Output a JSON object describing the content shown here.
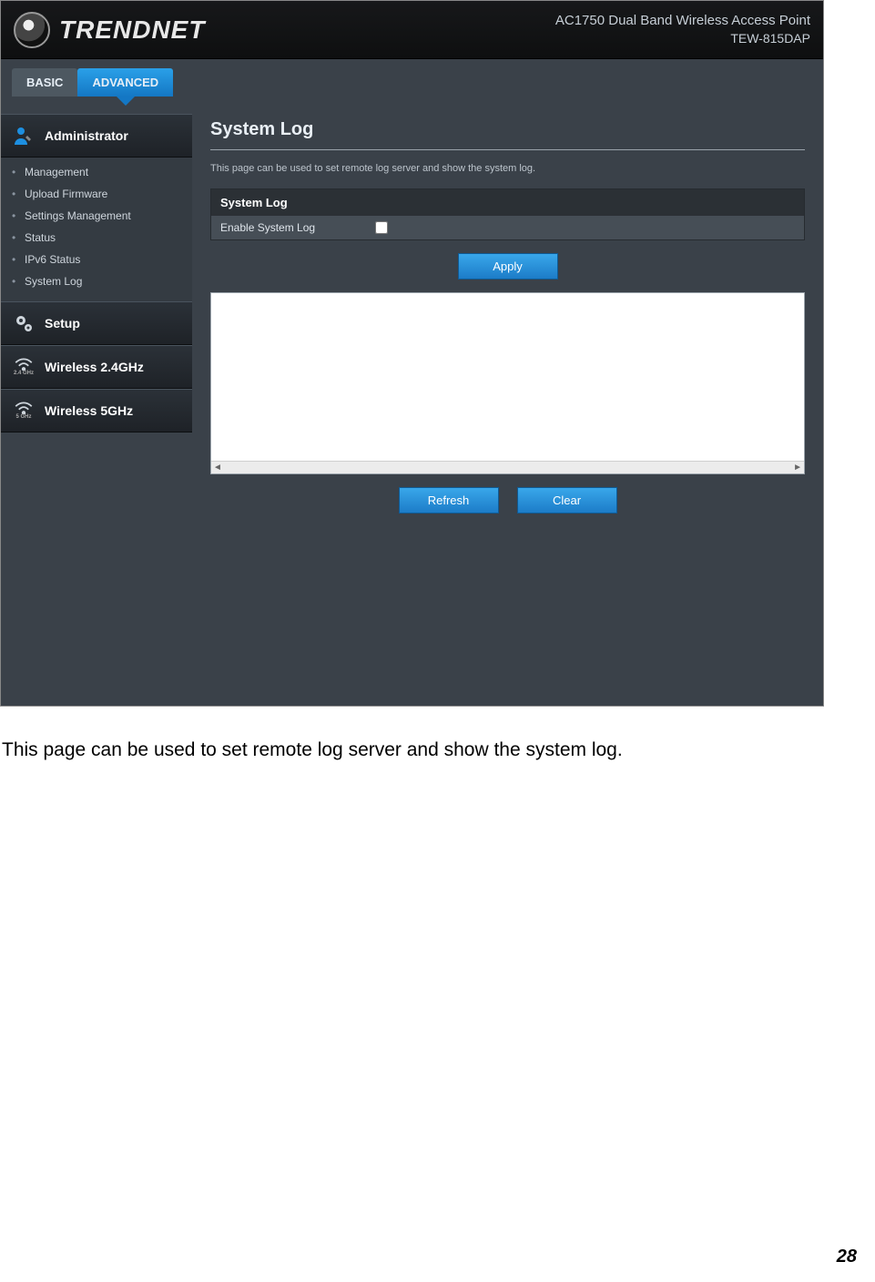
{
  "header": {
    "brand": "TRENDNET",
    "product_line": "AC1750 Dual Band Wireless Access Point",
    "model": "TEW-815DAP"
  },
  "tabs": {
    "basic": "BASIC",
    "advanced": "ADVANCED"
  },
  "sidebar": {
    "sections": [
      {
        "title": "Administrator",
        "items": [
          "Management",
          "Upload Firmware",
          "Settings Management",
          "Status",
          "IPv6 Status",
          "System Log"
        ]
      },
      {
        "title": "Setup",
        "items": []
      },
      {
        "title": "Wireless 2.4GHz",
        "items": [],
        "badge": "2.4 GHz"
      },
      {
        "title": "Wireless 5GHz",
        "items": [],
        "badge": "5 GHz"
      }
    ]
  },
  "main": {
    "title": "System Log",
    "description": "This page can be used to set remote log server and show the system log.",
    "panel_title": "System Log",
    "enable_label": "Enable System Log",
    "buttons": {
      "apply": "Apply",
      "refresh": "Refresh",
      "clear": "Clear"
    }
  },
  "caption": "This page can be used to set remote log server and show the system log.",
  "page_number": "28"
}
